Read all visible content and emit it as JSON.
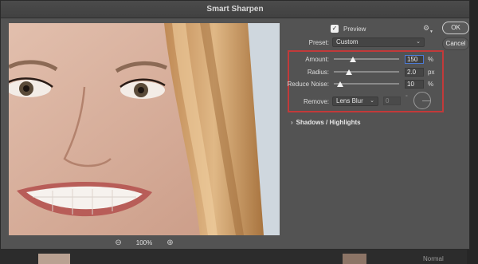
{
  "dialog": {
    "title": "Smart Sharpen"
  },
  "preview_pane": {
    "zoom_level": "100%",
    "zoom_out": "⊖",
    "zoom_in": "⊕"
  },
  "controls": {
    "preview_label": "Preview",
    "preview_checked": true,
    "preset_label": "Preset:",
    "preset_value": "Custom",
    "ok_label": "OK",
    "cancel_label": "Cancel",
    "amount": {
      "label": "Amount:",
      "value": "150",
      "unit": "%"
    },
    "radius": {
      "label": "Radius:",
      "value": "2.0",
      "unit": "px"
    },
    "reduce_noise": {
      "label": "Reduce Noise:",
      "value": "10",
      "unit": "%"
    },
    "remove": {
      "label": "Remove:",
      "value": "Lens Blur",
      "angle_value": "0",
      "angle_unit": "°"
    },
    "shadows_highlights": "Shadows / Highlights"
  },
  "background": {
    "layer_mode": "Normal"
  },
  "icons": {
    "gear": "gear-icon",
    "chevron": "chevron-right-icon",
    "zoom_in": "zoom-in-icon",
    "zoom_out": "zoom-out-icon"
  },
  "colors": {
    "highlight_frame": "#c23a3a",
    "dialog_bg": "#535353"
  }
}
